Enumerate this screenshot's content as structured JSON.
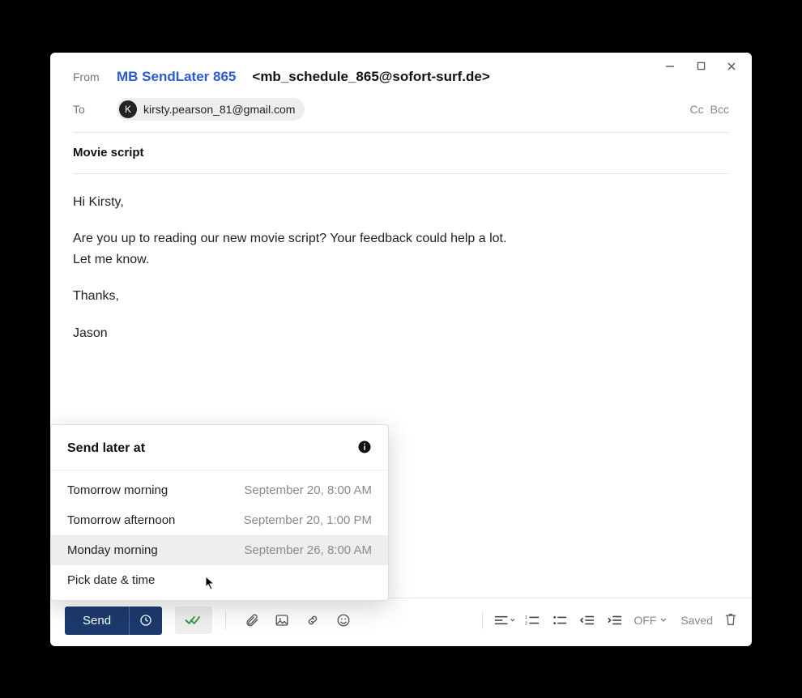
{
  "window": {
    "from_label": "From",
    "sender_name": "MB SendLater 865",
    "sender_email": "<mb_schedule_865@sofort-surf.de>",
    "to_label": "To",
    "recipient_initial": "K",
    "recipient_email": "kirsty.pearson_81@gmail.com",
    "cc_label": "Cc",
    "bcc_label": "Bcc",
    "subject": "Movie script",
    "body": {
      "l1": "Hi Kirsty,",
      "l2": "Are you up to reading our new movie script? Your feedback could help a lot.",
      "l3": "Let me know.",
      "l4": "Thanks,",
      "l5": "Jason"
    }
  },
  "toolbar": {
    "send_label": "Send",
    "off_label": "OFF",
    "saved_label": "Saved"
  },
  "popover": {
    "title": "Send later at",
    "items": [
      {
        "label": "Tomorrow morning",
        "time": "September 20, 8:00 AM",
        "hover": false
      },
      {
        "label": "Tomorrow afternoon",
        "time": "September 20, 1:00 PM",
        "hover": false
      },
      {
        "label": "Monday morning",
        "time": "September 26, 8:00 AM",
        "hover": true
      },
      {
        "label": "Pick date & time",
        "time": "",
        "hover": false
      }
    ]
  }
}
